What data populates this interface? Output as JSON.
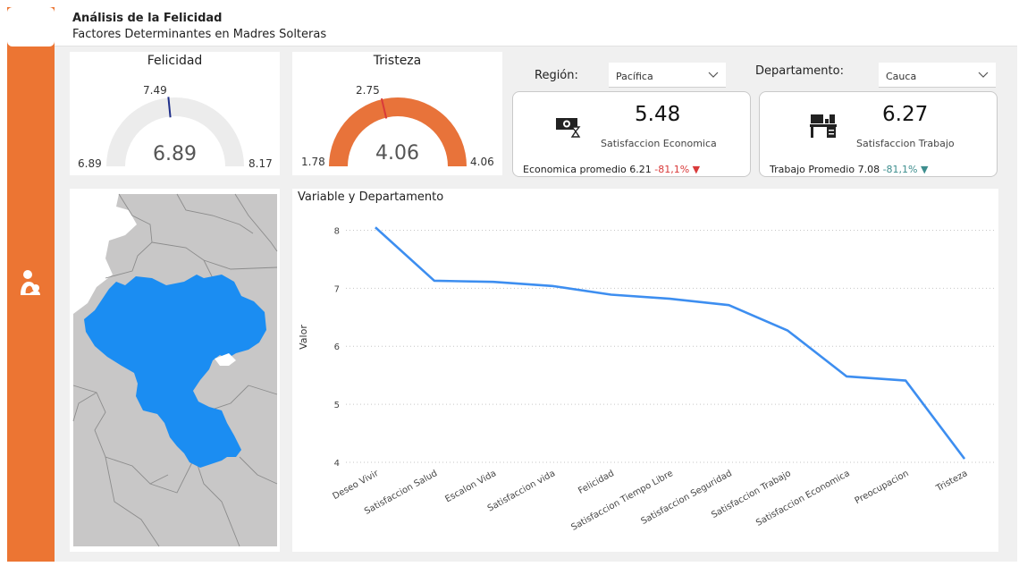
{
  "header": {
    "title": "Análisis de la Felicidad",
    "subtitle": "Factores Determinantes en Madres Solteras"
  },
  "sidebar": {
    "icon": "mother-child-icon",
    "accent": "#ec7533"
  },
  "gauges": {
    "felicidad": {
      "title": "Felicidad",
      "value": "6.89",
      "min": "6.89",
      "max": "8.17",
      "target": "7.49",
      "num": {
        "value": 6.89,
        "min": 6.89,
        "max": 8.17,
        "target": 7.49
      },
      "fill_color": "#d9d9d9",
      "target_color": "#1f2f8a"
    },
    "tristeza": {
      "title": "Tristeza",
      "value": "4.06",
      "min": "1.78",
      "max": "4.06",
      "target": "2.75",
      "num": {
        "value": 4.06,
        "min": 1.78,
        "max": 4.06,
        "target": 2.75
      },
      "fill_color": "#e8733a",
      "target_color": "#d93a3a"
    }
  },
  "filters": {
    "region": {
      "label": "Región:",
      "value": "Pacífica"
    },
    "departamento": {
      "label": "Departamento:",
      "value": "Cauca"
    }
  },
  "kpis": {
    "economica": {
      "value": "5.48",
      "label": "Satisfaccion Economica",
      "foot_label": "Economica promedio 6.21",
      "change": "-81,1%",
      "arrow": "▼",
      "arrow_color": "#d93a3a",
      "icon": "money-hourglass-icon"
    },
    "trabajo": {
      "value": "6.27",
      "label": "Satisfaccion Trabajo",
      "foot_label": "Trabajo Promedio 7.08",
      "change": "-81,1%",
      "arrow": "▼",
      "arrow_color": "#3e8e8e",
      "icon": "office-desk-icon"
    }
  },
  "map": {
    "highlight_color": "#1b8df2",
    "base_color": "#c8c7c7"
  },
  "chart_data": {
    "type": "line",
    "title": "Variable y Departamento",
    "xlabel": "",
    "ylabel": "Valor",
    "categories": [
      "Deseo Vivir",
      "Satisfaccion Salud",
      "Escalon Vida",
      "Satisfaccion vida",
      "Felicidad",
      "Satisfaccion Tiempo Libre",
      "Satisfaccion Seguridad",
      "Satisfaccion Trabajo",
      "Satisfaccion Economica",
      "Preocupacion",
      "Tristeza"
    ],
    "values": [
      8.05,
      7.13,
      7.11,
      7.04,
      6.89,
      6.82,
      6.71,
      6.27,
      5.48,
      5.41,
      4.06
    ],
    "ylim": [
      4,
      8.1
    ],
    "yticks": [
      "4",
      "5",
      "6",
      "7",
      "8"
    ],
    "line_color": "#3d8ef0",
    "grid": true
  }
}
